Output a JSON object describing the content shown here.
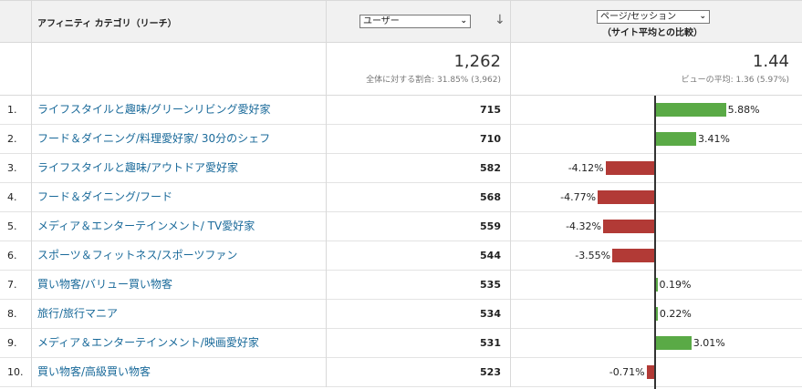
{
  "header": {
    "dimension_label": "アフィニティ カテゴリ（リーチ）",
    "users_select_value": "ユーザー",
    "sort_arrow": "↓",
    "metric_select_value": "ページ/セッション",
    "compare_label": "（サイト平均との比較）"
  },
  "totals": {
    "users_value": "1,262",
    "users_sub": "全体に対する割合: 31.85% (3,962)",
    "metric_value": "1.44",
    "metric_sub": "ビューの平均: 1.36 (5.97%)"
  },
  "rows": [
    {
      "num": "1.",
      "category": "ライフスタイルと趣味/グリーンリビング愛好家",
      "users": "715",
      "pct_label": "5.88%",
      "pct": 5.88
    },
    {
      "num": "2.",
      "category": "フード＆ダイニング/料理愛好家/ 30分のシェフ",
      "users": "710",
      "pct_label": "3.41%",
      "pct": 3.41
    },
    {
      "num": "3.",
      "category": "ライフスタイルと趣味/アウトドア愛好家",
      "users": "582",
      "pct_label": "-4.12%",
      "pct": -4.12
    },
    {
      "num": "4.",
      "category": "フード＆ダイニング/フード",
      "users": "568",
      "pct_label": "-4.77%",
      "pct": -4.77
    },
    {
      "num": "5.",
      "category": "メディア＆エンターテインメント/ TV愛好家",
      "users": "559",
      "pct_label": "-4.32%",
      "pct": -4.32
    },
    {
      "num": "6.",
      "category": "スポーツ＆フィットネス/スポーツファン",
      "users": "544",
      "pct_label": "-3.55%",
      "pct": -3.55
    },
    {
      "num": "7.",
      "category": "買い物客/バリュー買い物客",
      "users": "535",
      "pct_label": "0.19%",
      "pct": 0.19
    },
    {
      "num": "8.",
      "category": "旅行/旅行マニア",
      "users": "534",
      "pct_label": "0.22%",
      "pct": 0.22
    },
    {
      "num": "9.",
      "category": "メディア＆エンターテインメント/映画愛好家",
      "users": "531",
      "pct_label": "3.01%",
      "pct": 3.01
    },
    {
      "num": "10.",
      "category": "買い物客/高級買い物客",
      "users": "523",
      "pct_label": "-0.71%",
      "pct": -0.71
    }
  ],
  "colors": {
    "positive_bar": "#5aaa46",
    "negative_bar": "#b23a36",
    "link": "#1a6a9a"
  }
}
